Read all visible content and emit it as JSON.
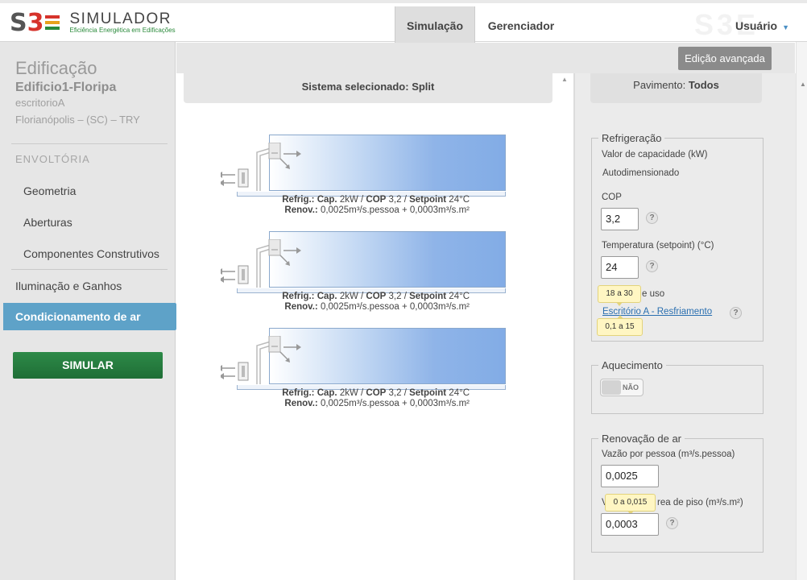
{
  "header": {
    "logo_mark": "S3E",
    "logo_title": "SIMULADOR",
    "logo_subtitle": "Eficiência Energética em Edificações",
    "tabs": [
      {
        "label": "Simulação",
        "active": true
      },
      {
        "label": "Gerenciador",
        "active": false
      }
    ],
    "user_label": "Usuário",
    "user_caret": "▼",
    "accent_colors": {
      "red": "#d6332b",
      "green": "#2a8a3b",
      "nav_active_bg": "#dedede"
    }
  },
  "sidebar": {
    "title": "Edificação",
    "building_name": "Edificio1-Floripa",
    "building_type": "escritorioA",
    "location": "Florianópolis – (SC) – TRY",
    "section_label": "ENVOLTÓRIA",
    "items": [
      {
        "label": "Geometria"
      },
      {
        "label": "Aberturas"
      },
      {
        "label": "Componentes Construtivos"
      }
    ],
    "item_lighting": "Iluminação e Ganhos",
    "active_item": "Condicionamento de ar",
    "simulate_label": "SIMULAR",
    "colors": {
      "active_bg": "#5ea2c8",
      "simulate_bg": "#2d8a48"
    }
  },
  "toolbar": {
    "advanced_edit_label": "Edição avançada"
  },
  "center": {
    "header_label": "Sistema selecionado: Split",
    "zones": [
      {
        "line1_a": "Refrig.:",
        "line1_b": " Cap.",
        "line1_c": " 2kW / ",
        "line1_d": "COP",
        "line1_e": " 3,2 / ",
        "line1_f": "Setpoint",
        "line1_g": " 24°C",
        "line2_a": "Renov.:",
        "line2_b": " 0,0025m³/s.pessoa + 0,0003m³/s.m²"
      },
      {
        "line1_a": "Refrig.:",
        "line1_b": " Cap.",
        "line1_c": " 2kW / ",
        "line1_d": "COP",
        "line1_e": " 3,2 / ",
        "line1_f": "Setpoint",
        "line1_g": " 24°C",
        "line2_a": "Renov.:",
        "line2_b": " 0,0025m³/s.pessoa + 0,0003m³/s.m²"
      },
      {
        "line1_a": "Refrig.:",
        "line1_b": " Cap.",
        "line1_c": " 2kW / ",
        "line1_d": "COP",
        "line1_e": " 3,2 / ",
        "line1_f": "Setpoint",
        "line1_g": " 24°C",
        "line2_a": "Renov.:",
        "line2_b": " 0,0025m³/s.pessoa + 0,0003m³/s.m²"
      }
    ]
  },
  "right": {
    "header_prefix": "Pavimento: ",
    "header_value": "Todos",
    "refrigeration": {
      "legend": "Refrigeração",
      "capacity_label": "Valor de capacidade (kW)",
      "capacity_value": "Autodimensionado",
      "cop_label": "COP",
      "cop_value": "3,2",
      "temp_label": "Temperatura (setpoint) (°C)",
      "temp_value": "24",
      "temp_tooltip": "18 a 30",
      "schedule_label_tail": "e uso",
      "schedule_link": "Escritório A - Resfriamento",
      "cop_tooltip": "0,1 a 15"
    },
    "heating": {
      "legend": "Aquecimento",
      "toggle_label": "NÃO",
      "toggle_on": false
    },
    "renewal": {
      "legend": "Renovação de ar",
      "per_person_label": "Vazão por pessoa (m³/s.pessoa)",
      "per_person_value": "0,0025",
      "per_area_label_head": "V",
      "per_area_label_tail": "rea de piso (m³/s.m²)",
      "per_area_tooltip": "0 a 0,015",
      "per_area_value": "0,0003"
    },
    "help_glyph": "?"
  }
}
